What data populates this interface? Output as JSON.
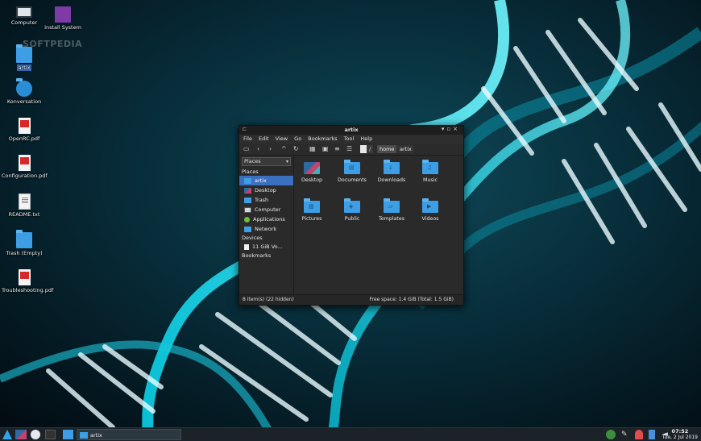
{
  "desktop": {
    "watermark": "SOFTPEDIA",
    "icons": [
      {
        "label": "Computer"
      },
      {
        "label": "Install System"
      },
      {
        "label": "artix"
      },
      {
        "label": "Konversation"
      },
      {
        "label": "OpenRC.pdf"
      },
      {
        "label": "Configuration.pdf"
      },
      {
        "label": "README.txt"
      },
      {
        "label": "Trash (Empty)"
      },
      {
        "label": "Troubleshooting.pdf"
      }
    ]
  },
  "window": {
    "title": "artix",
    "menu": [
      "File",
      "Edit",
      "View",
      "Go",
      "Bookmarks",
      "Tool",
      "Help"
    ],
    "path": {
      "root": "/",
      "segments": [
        "home",
        "artix"
      ]
    },
    "sidebar": {
      "selector": "Places",
      "places_heading": "Places",
      "places": [
        {
          "label": "artix",
          "icon": "home-folder-icon",
          "active": true
        },
        {
          "label": "Desktop",
          "icon": "desktop-icon"
        },
        {
          "label": "Trash",
          "icon": "trash-icon"
        },
        {
          "label": "Computer",
          "icon": "computer-icon"
        },
        {
          "label": "Applications",
          "icon": "applications-icon"
        },
        {
          "label": "Network",
          "icon": "network-icon"
        }
      ],
      "devices_heading": "Devices",
      "devices": [
        {
          "label": "11 GiB Vo..."
        }
      ],
      "bookmarks_heading": "Bookmarks"
    },
    "files": [
      {
        "label": "Desktop",
        "icon": "desktop-folder-icon"
      },
      {
        "label": "Documents",
        "icon": "documents-folder-icon"
      },
      {
        "label": "Downloads",
        "icon": "downloads-folder-icon"
      },
      {
        "label": "Music",
        "icon": "music-folder-icon"
      },
      {
        "label": "Pictures",
        "icon": "pictures-folder-icon"
      },
      {
        "label": "Public",
        "icon": "public-folder-icon"
      },
      {
        "label": "Templates",
        "icon": "templates-folder-icon"
      },
      {
        "label": "Videos",
        "icon": "videos-folder-icon"
      }
    ],
    "status": {
      "left": "8 item(s) (22 hidden)",
      "right": "Free space: 1.4 GiB (Total: 1.5 GiB)"
    }
  },
  "taskbar": {
    "task_label": "artix",
    "clock_time": "07:52",
    "clock_date": "Tue, 2 Jul 2019"
  }
}
